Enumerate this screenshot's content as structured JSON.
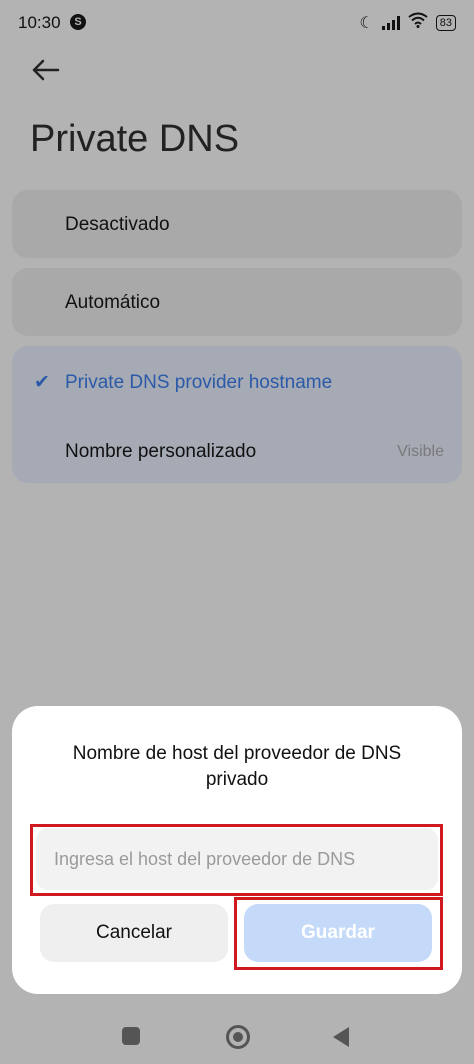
{
  "status_bar": {
    "time": "10:30",
    "app_badge": "S",
    "battery": "83"
  },
  "header": {
    "title": "Private DNS"
  },
  "options": {
    "off": "Desactivado",
    "auto": "Automático",
    "provider": "Private DNS provider hostname",
    "custom_name": "Nombre personalizado",
    "visible": "Visible",
    "selected": "provider"
  },
  "dialog": {
    "title": "Nombre de host del proveedor de DNS privado",
    "input_placeholder": "Ingresa el host del proveedor de DNS",
    "input_value": "",
    "cancel_label": "Cancelar",
    "save_label": "Guardar"
  },
  "colors": {
    "highlight": "#d0181f",
    "accent": "#2c5aa8",
    "save_disabled": "#c5daf9"
  },
  "icons": [
    "s-app-icon",
    "moon-icon",
    "signal-icon",
    "wifi-icon",
    "battery-icon",
    "back-arrow-icon",
    "checkmark-icon",
    "recent-apps-icon",
    "home-icon",
    "nav-back-icon"
  ]
}
